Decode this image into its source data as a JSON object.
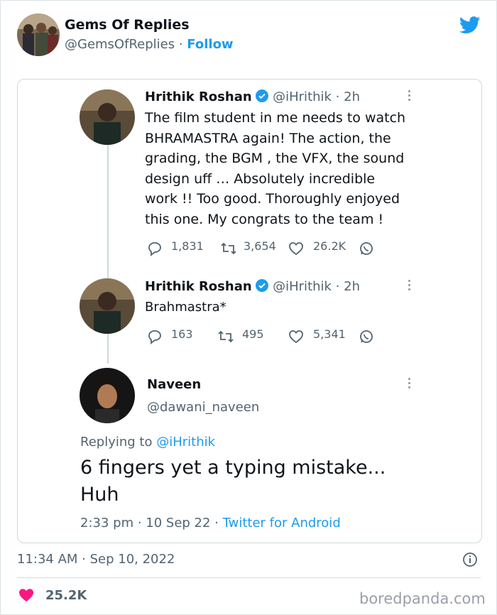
{
  "embed": {
    "account_name": "Gems Of Replies",
    "account_handle": "@GemsOfReplies",
    "follow_sep": "·",
    "follow_label": "Follow",
    "timestamp": "11:34 AM · Sep 10, 2022",
    "likes": "25.2K",
    "watermark": "boredpanda.com",
    "colors": {
      "accent": "#1d9bf0",
      "like": "#f91880",
      "text": "#0f1419",
      "muted": "#536471"
    }
  },
  "tweets": [
    {
      "name": "Hrithik Roshan",
      "handle": "@iHrithik · 2h",
      "text_lines": [
        "The film student in me needs to watch",
        "BHRAMASTRA again! The action, the",
        "grading, the BGM , the VFX, the sound",
        "design uff … Absolutely incredible",
        "work !! Too good. Thoroughly enjoyed",
        "this one. My congrats to the team !"
      ],
      "replies": "1,831",
      "retweets": "3,654",
      "likes": "26.2K"
    },
    {
      "name": "Hrithik Roshan",
      "handle": "@iHrithik · 2h",
      "text_lines": [
        "Brahmastra*"
      ],
      "replies": "163",
      "retweets": "495",
      "likes": "5,341"
    }
  ],
  "reply": {
    "name": "Naveen",
    "handle": "@dawani_naveen",
    "replying_prefix": "Replying to",
    "replying_to": "@iHrithik",
    "text_lines": [
      "6 fingers yet a typing mistake...",
      "Huh"
    ],
    "time_date": "2:33 pm · 10 Sep 22 ·",
    "source": "Twitter for Android"
  }
}
